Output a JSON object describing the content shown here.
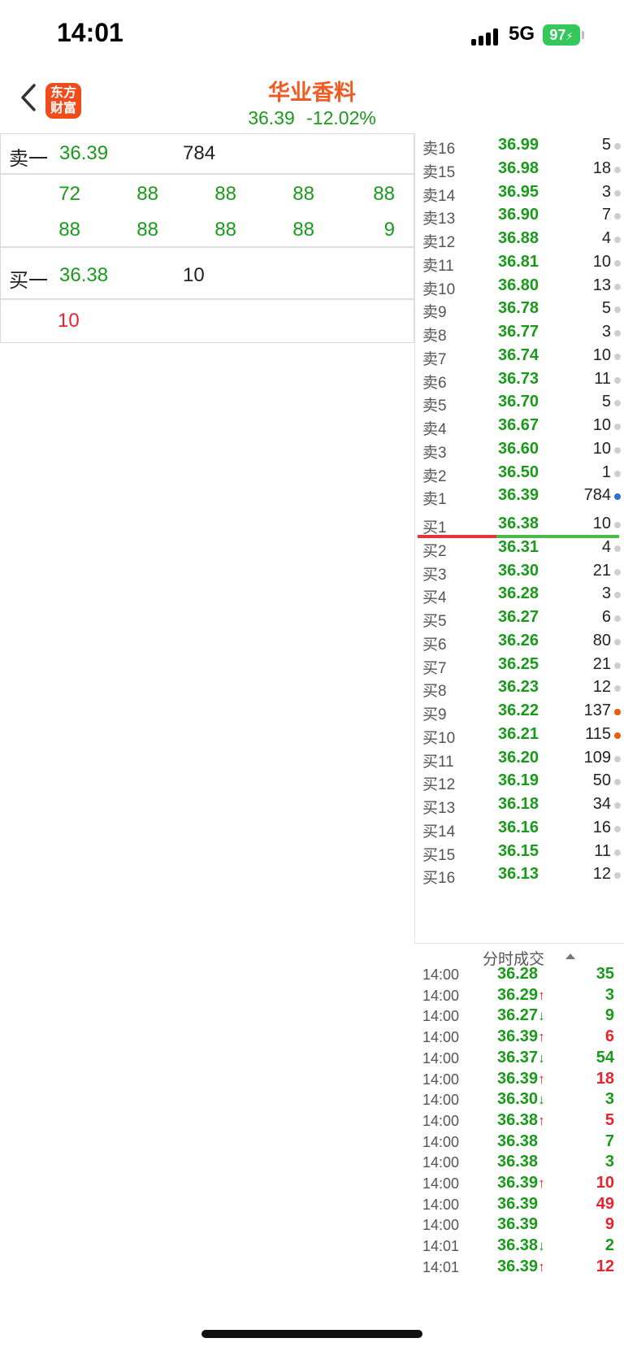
{
  "status_bar": {
    "time": "14:01",
    "network": "5G",
    "battery": "97"
  },
  "header": {
    "logo_line1": "东方",
    "logo_line2": "财富",
    "stock_name": "华业香料",
    "price": "36.39",
    "change_pct": "-12.02%"
  },
  "level1": {
    "sell_label": "卖一",
    "sell_price": "36.39",
    "sell_volume": "784",
    "sell_queue_row1": [
      "72",
      "88",
      "88",
      "88",
      "88"
    ],
    "sell_queue_row2": [
      "88",
      "88",
      "88",
      "88",
      "9"
    ],
    "buy_label": "买一",
    "buy_price": "36.38",
    "buy_volume": "10",
    "buy_queue": [
      "10"
    ]
  },
  "order_book": {
    "asks": [
      {
        "label": "卖16",
        "price": "36.99",
        "volume": "5",
        "dot": "gray"
      },
      {
        "label": "卖15",
        "price": "36.98",
        "volume": "18",
        "dot": "gray"
      },
      {
        "label": "卖14",
        "price": "36.95",
        "volume": "3",
        "dot": "gray"
      },
      {
        "label": "卖13",
        "price": "36.90",
        "volume": "7",
        "dot": "gray"
      },
      {
        "label": "卖12",
        "price": "36.88",
        "volume": "4",
        "dot": "gray"
      },
      {
        "label": "卖11",
        "price": "36.81",
        "volume": "10",
        "dot": "gray"
      },
      {
        "label": "卖10",
        "price": "36.80",
        "volume": "13",
        "dot": "gray"
      },
      {
        "label": "卖9",
        "price": "36.78",
        "volume": "5",
        "dot": "gray"
      },
      {
        "label": "卖8",
        "price": "36.77",
        "volume": "3",
        "dot": "gray"
      },
      {
        "label": "卖7",
        "price": "36.74",
        "volume": "10",
        "dot": "gray"
      },
      {
        "label": "卖6",
        "price": "36.73",
        "volume": "11",
        "dot": "gray"
      },
      {
        "label": "卖5",
        "price": "36.70",
        "volume": "5",
        "dot": "gray"
      },
      {
        "label": "卖4",
        "price": "36.67",
        "volume": "10",
        "dot": "gray"
      },
      {
        "label": "卖3",
        "price": "36.60",
        "volume": "10",
        "dot": "gray"
      },
      {
        "label": "卖2",
        "price": "36.50",
        "volume": "1",
        "dot": "gray"
      },
      {
        "label": "卖1",
        "price": "36.39",
        "volume": "784",
        "dot": "blue"
      }
    ],
    "bids": [
      {
        "label": "买1",
        "price": "36.38",
        "volume": "10",
        "dot": "gray"
      },
      {
        "label": "买2",
        "price": "36.31",
        "volume": "4",
        "dot": "gray"
      },
      {
        "label": "买3",
        "price": "36.30",
        "volume": "21",
        "dot": "gray"
      },
      {
        "label": "买4",
        "price": "36.28",
        "volume": "3",
        "dot": "gray"
      },
      {
        "label": "买5",
        "price": "36.27",
        "volume": "6",
        "dot": "gray"
      },
      {
        "label": "买6",
        "price": "36.26",
        "volume": "80",
        "dot": "gray"
      },
      {
        "label": "买7",
        "price": "36.25",
        "volume": "21",
        "dot": "gray"
      },
      {
        "label": "买8",
        "price": "36.23",
        "volume": "12",
        "dot": "gray"
      },
      {
        "label": "买9",
        "price": "36.22",
        "volume": "137",
        "dot": "orange"
      },
      {
        "label": "买10",
        "price": "36.21",
        "volume": "115",
        "dot": "orange"
      },
      {
        "label": "买11",
        "price": "36.20",
        "volume": "109",
        "dot": "gray"
      },
      {
        "label": "买12",
        "price": "36.19",
        "volume": "50",
        "dot": "gray"
      },
      {
        "label": "买13",
        "price": "36.18",
        "volume": "34",
        "dot": "gray"
      },
      {
        "label": "买14",
        "price": "36.16",
        "volume": "16",
        "dot": "gray"
      },
      {
        "label": "买15",
        "price": "36.15",
        "volume": "11",
        "dot": "gray"
      },
      {
        "label": "买16",
        "price": "36.13",
        "volume": "12",
        "dot": "gray"
      }
    ],
    "ratio_bar": {
      "sell_fraction": 0.39,
      "sell_color": "#e8323a",
      "buy_color": "#4cb848"
    }
  },
  "trades": {
    "title": "分时成交",
    "rows": [
      {
        "time": "14:00",
        "price": "36.28",
        "dir": "",
        "volume": "35",
        "vol_color": "green"
      },
      {
        "time": "14:00",
        "price": "36.29",
        "dir": "↑",
        "volume": "3",
        "vol_color": "green"
      },
      {
        "time": "14:00",
        "price": "36.27",
        "dir": "↓",
        "volume": "9",
        "vol_color": "green"
      },
      {
        "time": "14:00",
        "price": "36.39",
        "dir": "↑",
        "volume": "6",
        "vol_color": "red"
      },
      {
        "time": "14:00",
        "price": "36.37",
        "dir": "↓",
        "volume": "54",
        "vol_color": "green"
      },
      {
        "time": "14:00",
        "price": "36.39",
        "dir": "↑",
        "volume": "18",
        "vol_color": "red"
      },
      {
        "time": "14:00",
        "price": "36.30",
        "dir": "↓",
        "volume": "3",
        "vol_color": "green"
      },
      {
        "time": "14:00",
        "price": "36.38",
        "dir": "↑",
        "volume": "5",
        "vol_color": "red"
      },
      {
        "time": "14:00",
        "price": "36.38",
        "dir": "",
        "volume": "7",
        "vol_color": "green"
      },
      {
        "time": "14:00",
        "price": "36.38",
        "dir": "",
        "volume": "3",
        "vol_color": "green"
      },
      {
        "time": "14:00",
        "price": "36.39",
        "dir": "↑",
        "volume": "10",
        "vol_color": "red"
      },
      {
        "time": "14:00",
        "price": "36.39",
        "dir": "",
        "volume": "49",
        "vol_color": "red"
      },
      {
        "time": "14:00",
        "price": "36.39",
        "dir": "",
        "volume": "9",
        "vol_color": "red"
      },
      {
        "time": "14:01",
        "price": "36.38",
        "dir": "↓",
        "volume": "2",
        "vol_color": "green"
      },
      {
        "time": "14:01",
        "price": "36.39",
        "dir": "↑",
        "volume": "12",
        "vol_color": "red"
      }
    ]
  }
}
